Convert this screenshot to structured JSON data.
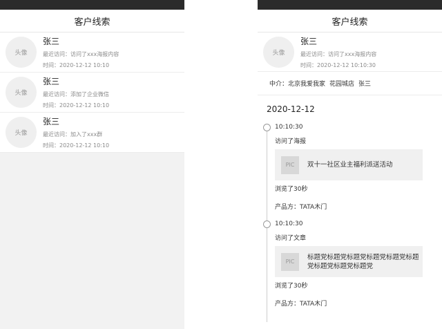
{
  "left_screen": {
    "title": "客户线索",
    "leads": [
      {
        "avatar": "头像",
        "name": "张三",
        "recent": "最近访问：访问了xxx海报内容",
        "time": "时间：2020-12-12 10:10"
      },
      {
        "avatar": "头像",
        "name": "张三",
        "recent": "最近访问：添加了企业微信",
        "time": "时间：2020-12-12 10:10"
      },
      {
        "avatar": "头像",
        "name": "张三",
        "recent": "最近访问：加入了xxx群",
        "time": "时间：2020-12-12 10:10"
      }
    ]
  },
  "right_screen": {
    "title": "客户线索",
    "profile": {
      "avatar": "头像",
      "name": "张三",
      "recent": "最近访问：访问了xxx海报内容",
      "time": "时间：2020-12-12 10:10:30"
    },
    "agent": {
      "label": "中介：",
      "company": "北京我爱我家",
      "store": "花园城店",
      "person": "张三"
    },
    "date": "2020-12-12",
    "timeline": [
      {
        "time": "10:10:30",
        "action": "访问了海报",
        "pic": "PIC",
        "card_title": "双十一社区业主福利派送活动",
        "duration": "浏览了30秒",
        "producer": "产品方：TATA木门"
      },
      {
        "time": "10:10:30",
        "action": "访问了文章",
        "pic": "PIC",
        "card_title": "标题党标题党标题党标题党标题党标题党标题党标题党标题党",
        "duration": "浏览了30秒",
        "producer": "产品方：TATA木门"
      }
    ]
  }
}
